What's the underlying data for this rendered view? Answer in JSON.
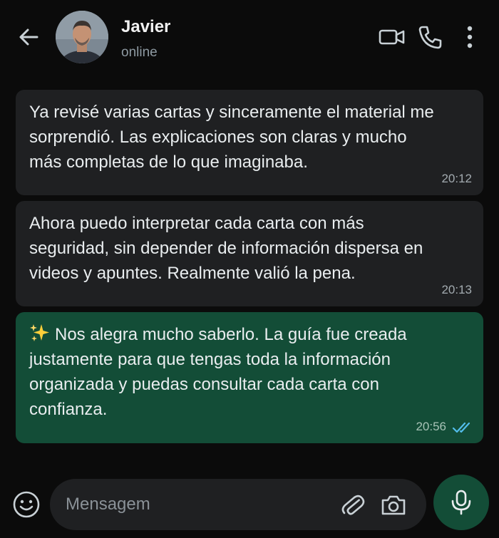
{
  "header": {
    "contact_name": "Javier",
    "status": "online",
    "icons": [
      "back-arrow-icon",
      "video-call-icon",
      "voice-call-icon",
      "more-options-icon"
    ]
  },
  "messages": [
    {
      "direction": "incoming",
      "text": "Ya revisé varias cartas y sinceramente el material me\nsorprendió. Las explicaciones son claras y mucho\nmás completas de lo que imaginaba.",
      "time": "20:12"
    },
    {
      "direction": "incoming",
      "text": "Ahora puedo interpretar cada carta con más\nseguridad, sin depender de información dispersa en\nvideos y apuntes. Realmente valió la pena.",
      "time": "20:13"
    },
    {
      "direction": "outgoing",
      "text": "Nos alegra mucho saberlo. La guía fue creada\njustamente para que tengas toda la información\norganizada y puedas consultar cada carta con\nconfianza.",
      "time": "20:56",
      "status": "read",
      "leading_icon": "sparkles-icon"
    }
  ],
  "composer": {
    "placeholder": "Mensagem",
    "value": ""
  },
  "colors": {
    "background": "#0b0b0b",
    "incoming_bubble": "#1f2022",
    "outgoing_bubble": "#134d37",
    "read_ticks": "#53bdeb",
    "sparkles": "#ffcf3a"
  }
}
